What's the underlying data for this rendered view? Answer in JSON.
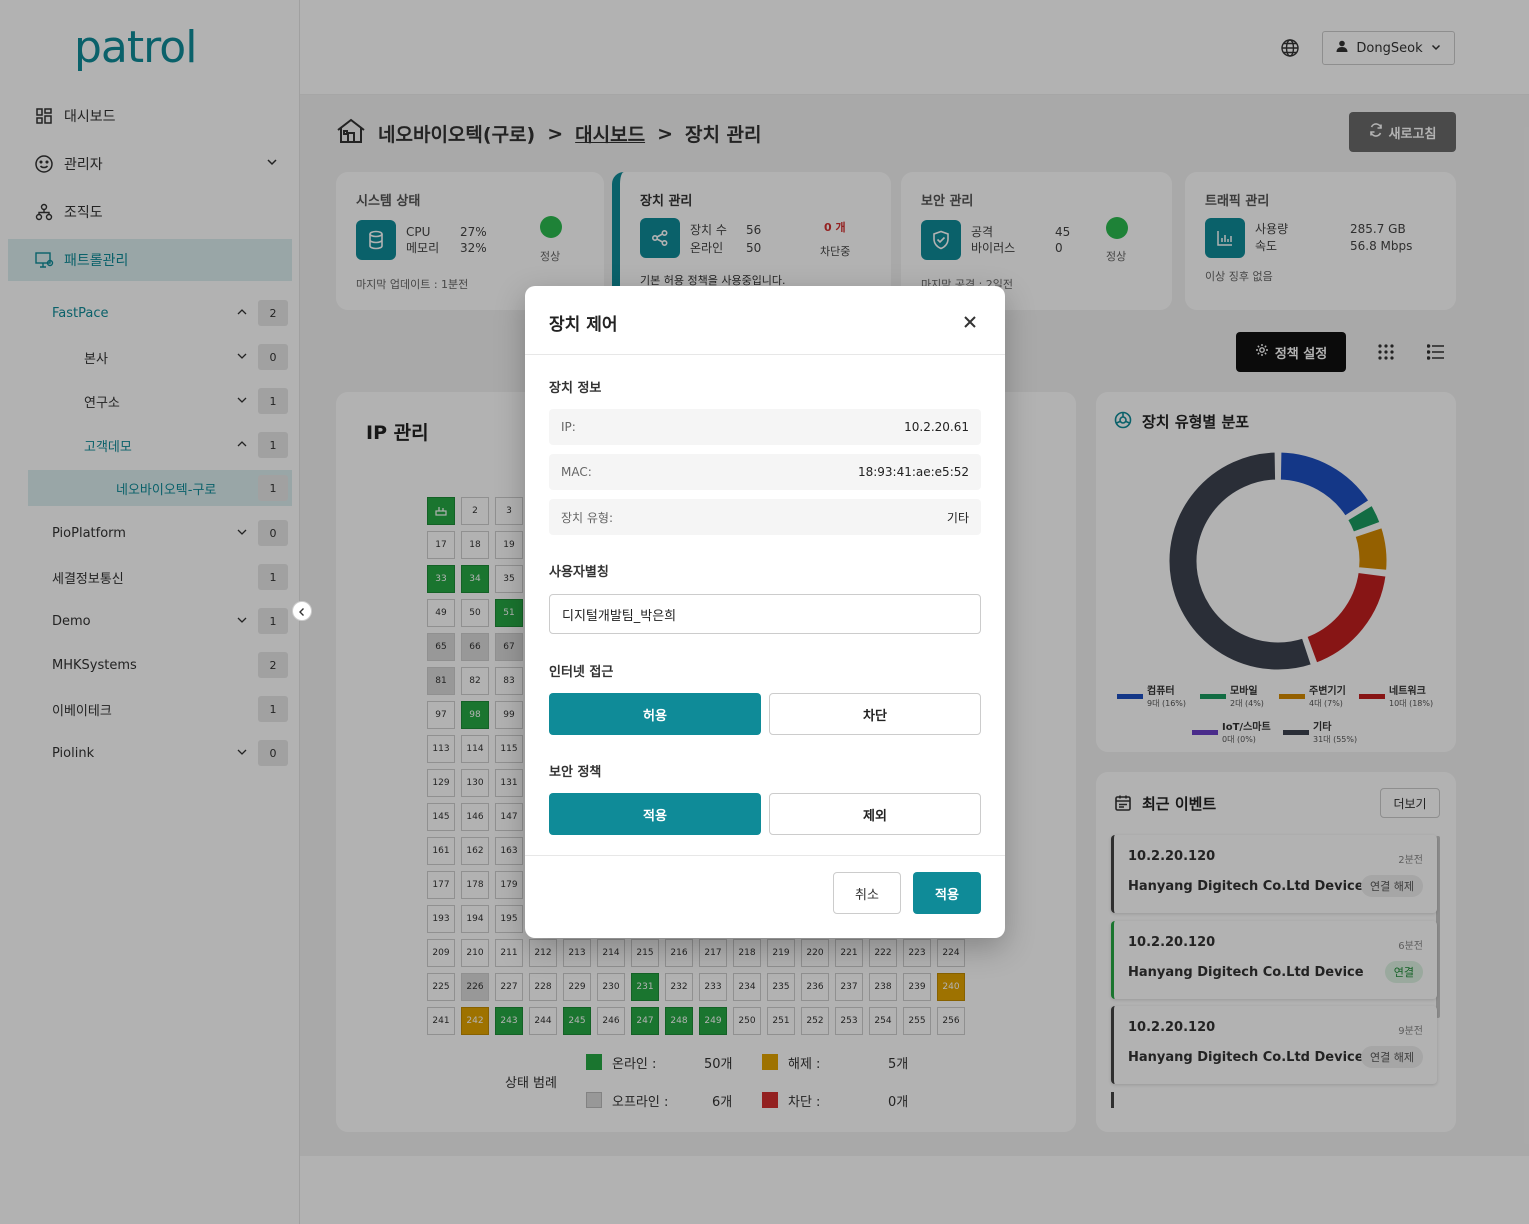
{
  "app": {
    "logo": "patrol"
  },
  "sidebar": {
    "nav": [
      {
        "label": "대시보드",
        "icon": "grid-icon"
      },
      {
        "label": "관리자",
        "icon": "smile-icon"
      },
      {
        "label": "조직도",
        "icon": "org-chart-icon"
      },
      {
        "label": "패트롤관리",
        "icon": "monitor-icon"
      }
    ],
    "tree": [
      {
        "label": "FastPace",
        "count": "2"
      },
      {
        "label": "본사",
        "count": "0"
      },
      {
        "label": "연구소",
        "count": "1"
      },
      {
        "label": "고객데모",
        "count": "1"
      },
      {
        "label": "네오바이오텍-구로",
        "count": "1"
      },
      {
        "label": "PioPlatform",
        "count": "0"
      },
      {
        "label": "세결정보통신",
        "count": "1"
      },
      {
        "label": "Demo",
        "count": "1"
      },
      {
        "label": "MHKSystems",
        "count": "2"
      },
      {
        "label": "이베이테크",
        "count": "1"
      },
      {
        "label": "Piolink",
        "count": "0"
      }
    ]
  },
  "topbar": {
    "user": "DongSeok"
  },
  "breadcrumb": {
    "site": "네오바이오텍(구로)",
    "sep1": ">",
    "dashboard": "대시보드",
    "sep2": ">",
    "page": "장치 관리"
  },
  "refresh_label": "새로고침",
  "cards": {
    "system": {
      "title": "시스템 상태",
      "k1": "CPU",
      "v1": "27%",
      "k2": "메모리",
      "v2": "32%",
      "status": "정상",
      "footer": "마지막 업데이트 : 1분전"
    },
    "device": {
      "title": "장치 관리",
      "k1": "장치 수",
      "v1": "56",
      "k2": "온라인",
      "v2": "50",
      "blocked_count": "0 개",
      "blocked_label": "차단중",
      "footer": "기본 허용 정책을 사용중입니다."
    },
    "security": {
      "title": "보안 관리",
      "k1": "공격",
      "v1": "45",
      "k2": "바이러스",
      "v2": "0",
      "status": "정상",
      "footer": "마지막 공격 : 2일전"
    },
    "traffic": {
      "title": "트래픽 관리",
      "k1": "사용량",
      "v1": "285.7 GB",
      "k2": "속도",
      "v2": "56.8 Mbps",
      "footer": "이상 징후 없음"
    }
  },
  "policy_label": "정책 설정",
  "ip_panel": {
    "title": "IP 관리",
    "legend_title": "상태 범례",
    "legend": [
      {
        "label": "온라인 :",
        "value": "50개",
        "color": "#26a844"
      },
      {
        "label": "해제 :",
        "value": "5개",
        "color": "#e2a400"
      },
      {
        "label": "오프라인 :",
        "value": "6개",
        "color": "#dadada"
      },
      {
        "label": "차단 :",
        "value": "0개",
        "color": "#d32f2f"
      }
    ]
  },
  "distribution": {
    "title": "장치 유형별 분포",
    "legend": [
      {
        "name": "컴퓨터",
        "detail": "9대 (16%)",
        "color": "#1e4fc2"
      },
      {
        "name": "모바일",
        "detail": "2대 (4%)",
        "color": "#1a9b60"
      },
      {
        "name": "주변기기",
        "detail": "4대 (7%)",
        "color": "#d48a00"
      },
      {
        "name": "네트워크",
        "detail": "10대 (18%)",
        "color": "#c21f1f"
      },
      {
        "name": "IoT/스마트",
        "detail": "0대 (0%)",
        "color": "#6a3fc8"
      },
      {
        "name": "기타",
        "detail": "31대 (55%)",
        "color": "#3d4350"
      }
    ]
  },
  "events": {
    "title": "최근 이벤트",
    "more": "더보기",
    "items": [
      {
        "ip": "10.2.20.120",
        "time": "2분전",
        "device": "Hanyang Digitech Co.Ltd Device",
        "status": "연결 해제"
      },
      {
        "ip": "10.2.20.120",
        "time": "6분전",
        "device": "Hanyang Digitech Co.Ltd Device",
        "status": "연결"
      },
      {
        "ip": "10.2.20.120",
        "time": "9분전",
        "device": "Hanyang Digitech Co.Ltd Device",
        "status": "연결 해제"
      }
    ]
  },
  "modal": {
    "title": "장치 제어",
    "info_title": "장치 정보",
    "ip_key": "IP:",
    "ip_val": "10.2.20.61",
    "mac_key": "MAC:",
    "mac_val": "18:93:41:ae:e5:52",
    "type_key": "장치 유형:",
    "type_val": "기타",
    "alias_title": "사용자별칭",
    "alias_value": "디지털개발팀_박은희",
    "internet_title": "인터넷 접근",
    "allow": "허용",
    "block": "차단",
    "security_title": "보안 정책",
    "apply_policy": "적용",
    "exclude": "제외",
    "cancel": "취소",
    "apply": "적용"
  }
}
